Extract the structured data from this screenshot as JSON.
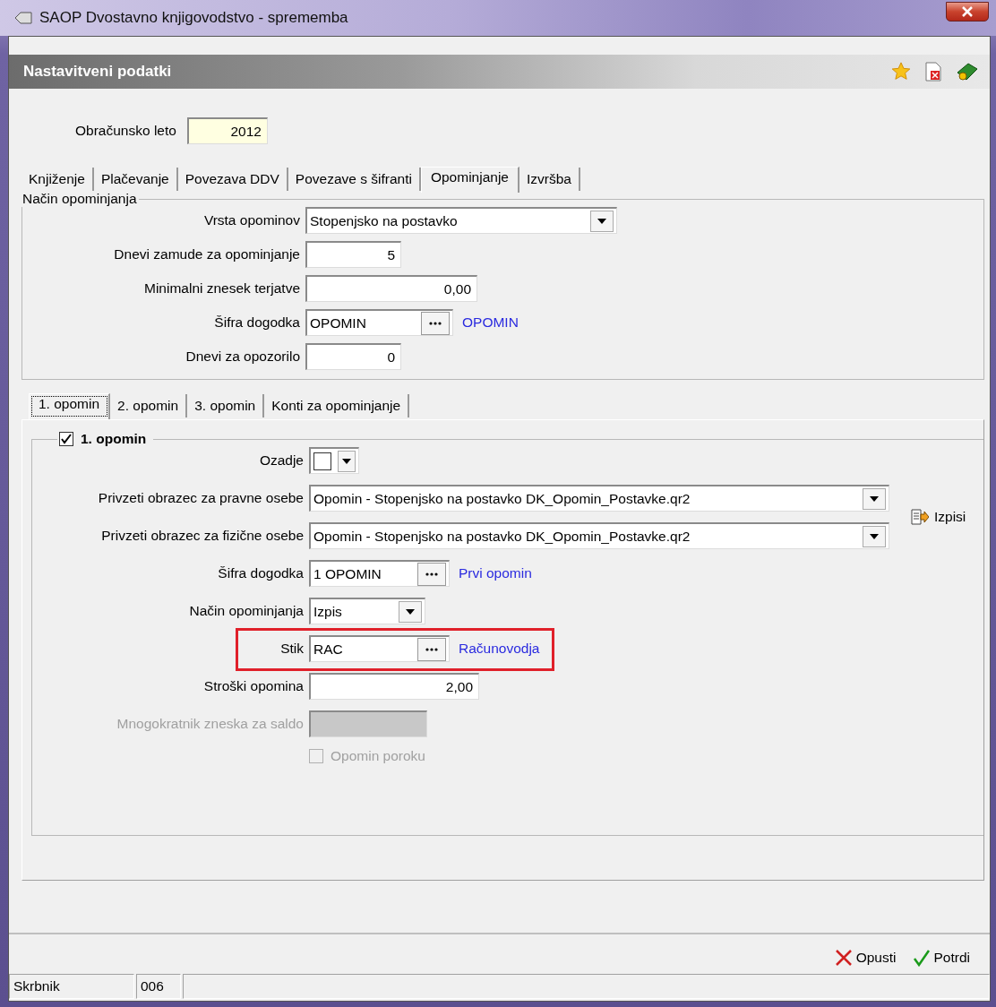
{
  "window": {
    "title": "SAOP  Dvostavno knjigovodstvo - sprememba"
  },
  "header": {
    "title": "Nastavitveni podatki"
  },
  "year": {
    "label": "Obračunsko leto",
    "value": "2012"
  },
  "tabs": [
    {
      "label": "Knjiženje",
      "selected": false
    },
    {
      "label": "Plačevanje",
      "selected": false
    },
    {
      "label": "Povezava DDV",
      "selected": false
    },
    {
      "label": "Povezave s šifranti",
      "selected": false
    },
    {
      "label": "Opominjanje",
      "selected": true
    },
    {
      "label": "Izvršba",
      "selected": false
    }
  ],
  "group": {
    "title": "Način opominjanja",
    "fields": [
      {
        "kind": "combo",
        "label": "Vrsta opominov",
        "value": "Stopenjsko na postavko"
      },
      {
        "kind": "number",
        "label": "Dnevi zamude za opominjanje",
        "value": "5"
      },
      {
        "kind": "amount",
        "label": "Minimalni znesek terjatve",
        "value": "0,00"
      },
      {
        "kind": "lookup",
        "label": "Šifra dogodka",
        "value": "OPOMIN",
        "link": "OPOMIN"
      },
      {
        "kind": "number",
        "label": "Dnevi za opozorilo",
        "value": "0"
      }
    ]
  },
  "subtabs": [
    {
      "label": "1. opomin",
      "selected": true
    },
    {
      "label": "2. opomin",
      "selected": false
    },
    {
      "label": "3. opomin",
      "selected": false
    },
    {
      "label": "Konti za opominjanje",
      "selected": false
    }
  ],
  "reminder": {
    "title": "1. opomin",
    "checked": true,
    "side_button": "Izpisi",
    "fields": [
      {
        "kind": "color",
        "label": "Ozadje"
      },
      {
        "kind": "template",
        "label": "Privzeti obrazec za pravne osebe",
        "value": "Opomin - Stopenjsko na postavko DK_Opomin_Postavke.qr2"
      },
      {
        "kind": "template",
        "label": "Privzeti obrazec za fizične osebe",
        "value": "Opomin - Stopenjsko na postavko DK_Opomin_Postavke.qr2"
      },
      {
        "kind": "lookup",
        "label": "Šifra dogodka",
        "value": "1 OPOMIN",
        "link": "Prvi opomin",
        "highlighted": false
      },
      {
        "kind": "smallcombo",
        "label": "Način opominjanja",
        "value": "Izpis"
      },
      {
        "kind": "lookup",
        "label": "Stik",
        "value": "RAC",
        "link": "Računovodja",
        "highlighted": true
      },
      {
        "kind": "amount",
        "label": "Stroški opomina",
        "value": "2,00"
      },
      {
        "kind": "empty",
        "label": "Mnogokratnik zneska za saldo",
        "disabled": true
      },
      {
        "kind": "checkbox",
        "label": "Opomin poroku",
        "checked": false,
        "disabled": true
      }
    ]
  },
  "buttons": [
    {
      "kind": "cancel",
      "label": "Opusti"
    },
    {
      "kind": "confirm",
      "label": "Potrdi"
    }
  ],
  "status_bar": {
    "user": "Skrbnik",
    "code": "006"
  }
}
